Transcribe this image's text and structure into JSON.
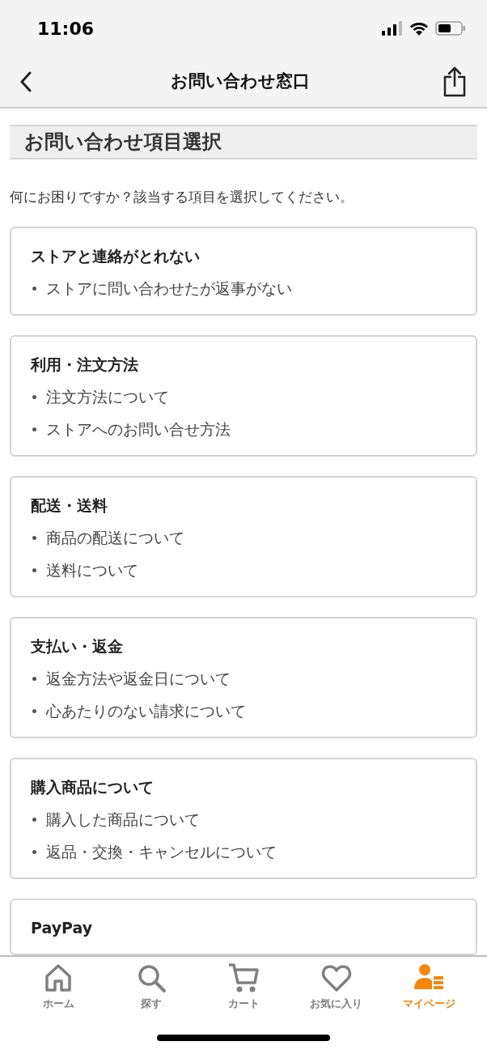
{
  "status_bar": {
    "time": "11:06"
  },
  "header": {
    "title": "お問い合わせ窓口"
  },
  "section_title": "お問い合わせ項目選択",
  "intro": "何にお困りですか？該当する項目を選択してください。",
  "categories": [
    {
      "title": "ストアと連絡がとれない",
      "items": [
        "ストアに問い合わせたが返事がない"
      ]
    },
    {
      "title": "利用・注文方法",
      "items": [
        "注文方法について",
        "ストアへのお問い合せ方法"
      ]
    },
    {
      "title": "配送・送料",
      "items": [
        "商品の配送について",
        "送料について"
      ]
    },
    {
      "title": "支払い・返金",
      "items": [
        "返金方法や返金日について",
        "心あたりのない請求について"
      ]
    },
    {
      "title": "購入商品について",
      "items": [
        "購入した商品について",
        "返品・交換・キャンセルについて"
      ]
    },
    {
      "title": "PayPay"
    }
  ],
  "bottom_nav": [
    {
      "kind": "home",
      "label": "ホーム",
      "selected": false
    },
    {
      "kind": "search",
      "label": "探す",
      "selected": false
    },
    {
      "kind": "cart",
      "label": "カート",
      "selected": false
    },
    {
      "kind": "heart",
      "label": "お気に入り",
      "selected": false
    },
    {
      "kind": "user",
      "label": "マイページ",
      "selected": true
    }
  ]
}
